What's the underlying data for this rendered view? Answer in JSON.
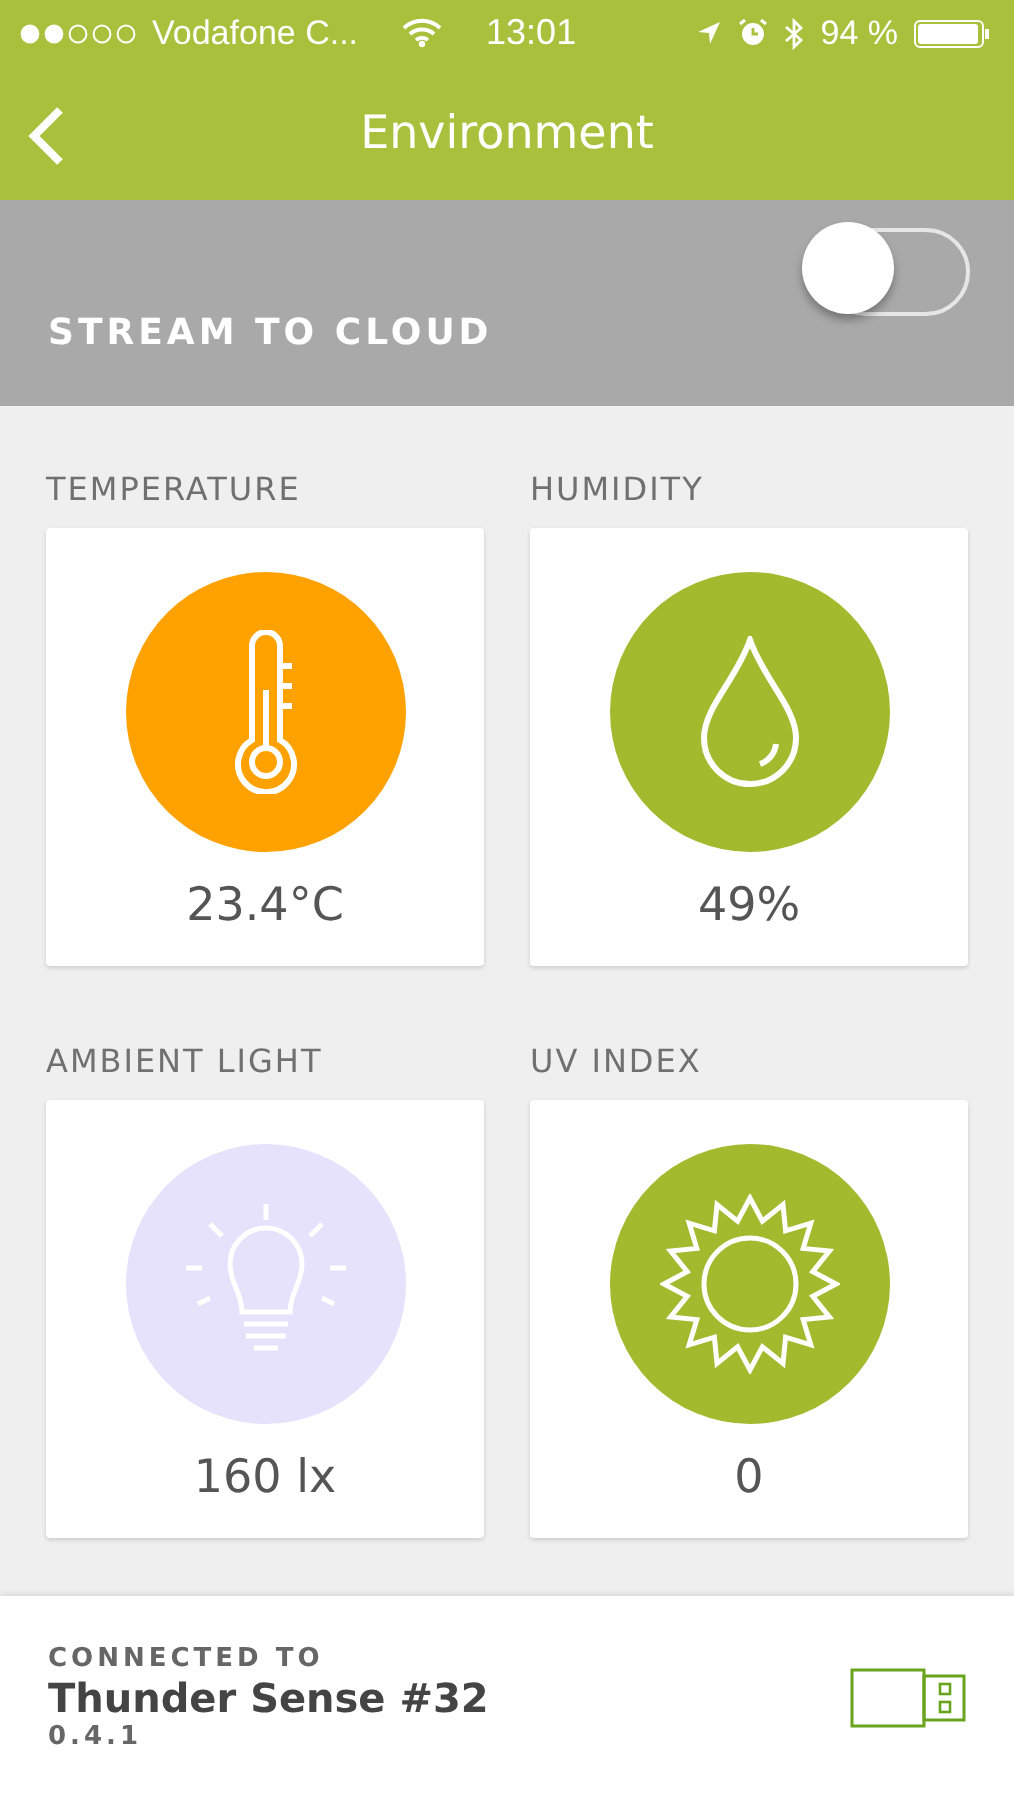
{
  "status_bar": {
    "carrier": "Vodafone C...",
    "time": "13:01",
    "battery": "94 %"
  },
  "header": {
    "title": "Environment"
  },
  "stream": {
    "label": "STREAM TO CLOUD",
    "on": false
  },
  "sensors": [
    {
      "kind": "temperature",
      "label": "TEMPERATURE",
      "value": "23.4°C",
      "color": "#ffa200"
    },
    {
      "kind": "humidity",
      "label": "HUMIDITY",
      "value": "49%",
      "color": "#a3ba2f"
    },
    {
      "kind": "light",
      "label": "AMBIENT LIGHT",
      "value": "160 lx",
      "color": "#e6e2fc"
    },
    {
      "kind": "uv",
      "label": "UV INDEX",
      "value": "0",
      "color": "#a3ba2f"
    }
  ],
  "footer": {
    "caption": "CONNECTED TO",
    "device": "Thunder Sense #32",
    "version": "0.4.1"
  }
}
